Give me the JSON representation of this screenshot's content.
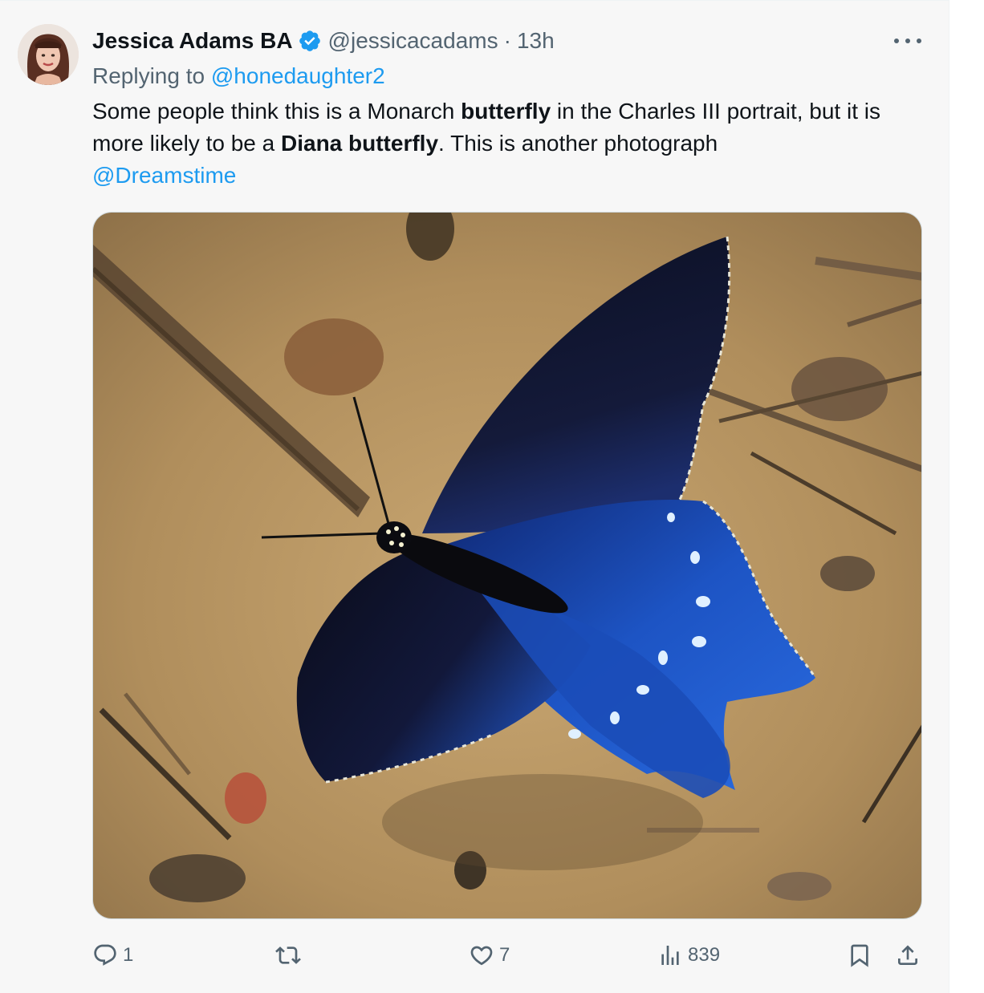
{
  "tweet": {
    "author": {
      "name": "Jessica Adams BA",
      "handle": "@jessicacadams",
      "separator": "·",
      "time": "13h"
    },
    "reply": {
      "prefix": "Replying to ",
      "mention": "@honedaughter2"
    },
    "text": {
      "part1": "Some people think this is a Monarch ",
      "bold1": "butterfly",
      "part2": " in the Charles III portrait, but it is more likely to be a ",
      "bold2": "Diana butterfly",
      "part3": ". This is another photograph ",
      "link": "@Dreamstime"
    },
    "media": {
      "image_icon": "butterfly-photo"
    },
    "actions": {
      "reply_count": "1",
      "retweet_count": "",
      "like_count": "7",
      "views_count": "839"
    },
    "icons": {
      "verified": "verified-badge-icon",
      "more": "more-icon",
      "reply": "reply-icon",
      "retweet": "retweet-icon",
      "like": "heart-icon",
      "views": "views-icon",
      "bookmark": "bookmark-icon",
      "share": "share-icon"
    },
    "colors": {
      "accent": "#1d9bf0",
      "secondary_text": "#536471",
      "background": "#f7f7f7"
    }
  }
}
